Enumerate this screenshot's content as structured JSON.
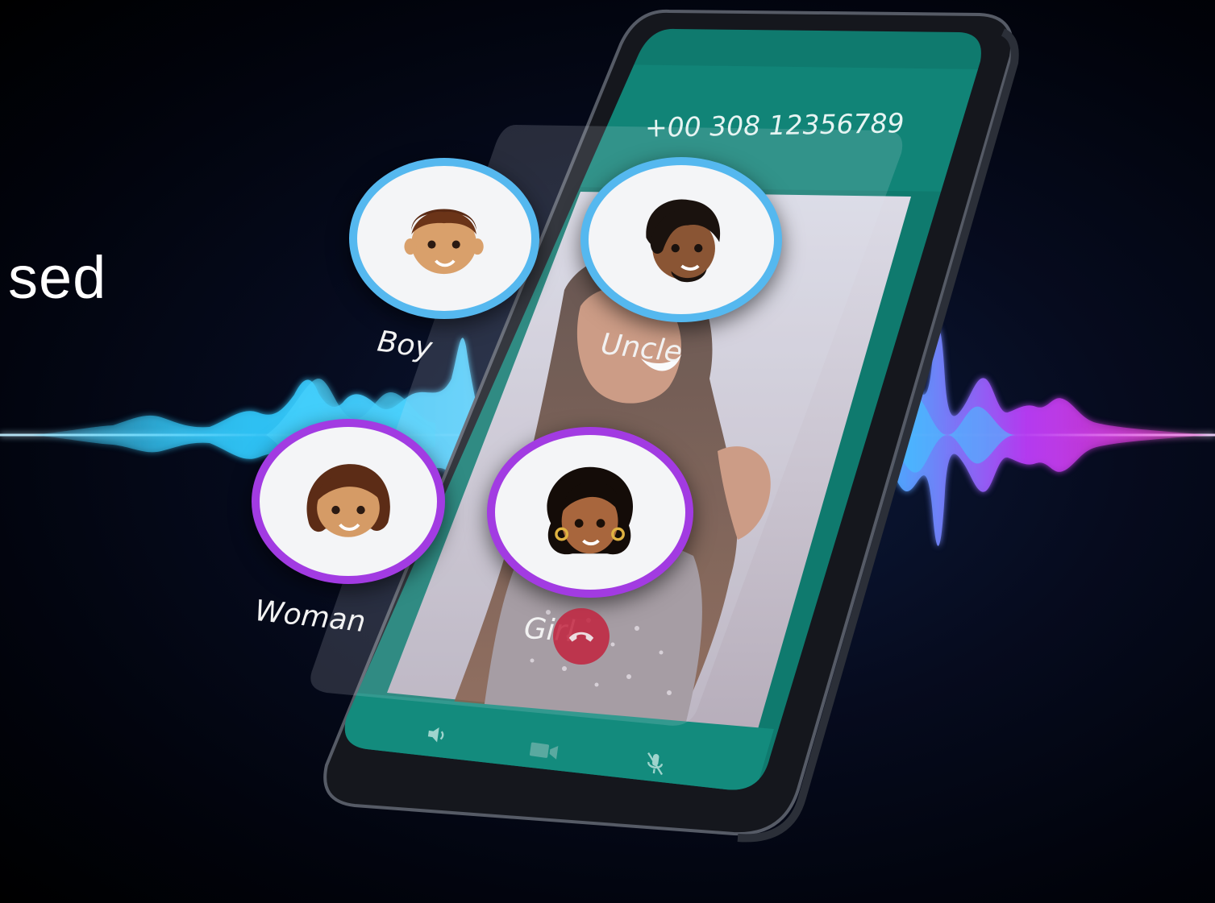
{
  "overlay_text": "sed",
  "call": {
    "phone_number": "+00 308 12356789"
  },
  "voices": [
    {
      "label": "Boy",
      "ring_color": "#55b8ef"
    },
    {
      "label": "Uncle",
      "ring_color": "#55b8ef"
    },
    {
      "label": "Woman",
      "ring_color": "#a23be2"
    },
    {
      "label": "Girl",
      "ring_color": "#a23be2"
    }
  ],
  "controls": {
    "speaker_icon": "speaker-icon",
    "video_icon": "video-camera-icon",
    "mute_icon": "microphone-mute-icon",
    "end_call_icon": "phone-hangup-icon"
  },
  "colors": {
    "screen_teal": "#0f7a6e",
    "screen_teal_light": "#138b7d",
    "end_call": "#c2243f",
    "wave_cyan": "#22c7f2",
    "wave_magenta": "#d22ee6"
  }
}
